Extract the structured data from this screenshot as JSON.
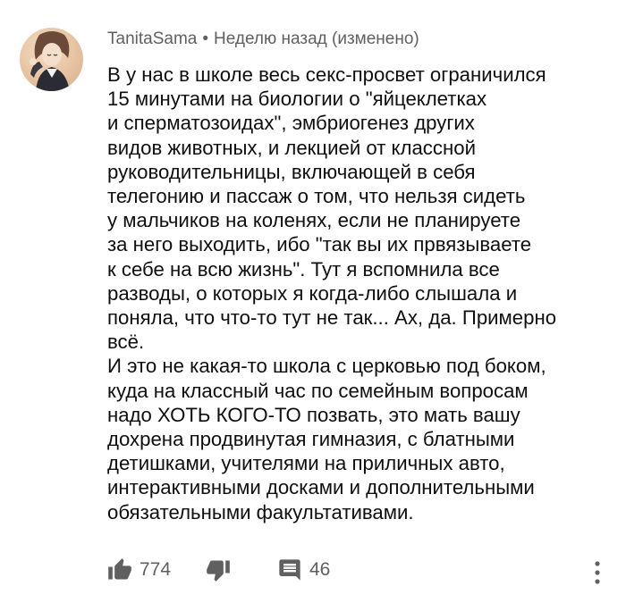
{
  "comment": {
    "author": "TanitaSama",
    "separator": "•",
    "timestamp": "Неделю назад (изменено)",
    "lines": [
      "В у нас в школе весь секс-просвет ограничился",
      "15 минутами на биологии о \"яйцеклетках",
      "и сперматозоидах\", эмбриогенез других",
      "видов животных, и лекцией от классной",
      "руководительницы, включающей в себя",
      "телегонию и пассаж о том, что нельзя сидеть",
      "у мальчиков на коленях, если не планируете",
      "за него выходить, ибо \"так вы их првязываете",
      "к себе на всю жизнь\". Тут я вспомнила все",
      "разводы, о которых я когда-либо слышала и",
      "поняла, что что-то тут не так... Ах, да. Примерно",
      "всё.",
      "И это не какая-то школа с церковью под боком,",
      "куда на классный час по семейным вопросам",
      "надо ХОТЬ КОГО-ТО позвать, это мать вашу",
      "дохрена продвинутая гимназия, с блатными",
      "детишками, учителями на приличных авто,",
      "интерактивными досками и дополнительными",
      "обязательными факультативами."
    ]
  },
  "actions": {
    "like_icon": "thumbs-up-icon",
    "like_count": "774",
    "dislike_icon": "thumbs-down-icon",
    "reply_icon": "comment-icon",
    "reply_count": "46",
    "more_icon": "vertical-dots-icon"
  },
  "colors": {
    "text": "#0f0f0f",
    "meta": "#606060",
    "icon": "#606060",
    "background": "#ffffff"
  }
}
